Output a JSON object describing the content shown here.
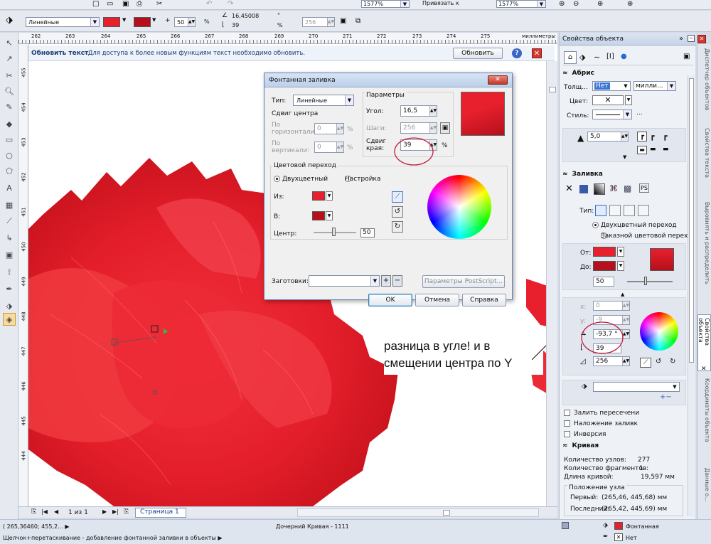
{
  "top_toolbar": {
    "zoom1": "1577%",
    "snap": "Привязать к",
    "zoom2": "1577%"
  },
  "prop_bar": {
    "fill_type": "Линейные",
    "midpoint": "50",
    "midpoint_unit": "%",
    "angle": "16,45008",
    "angle_unit": "°",
    "edge": "39",
    "edge_unit": "%",
    "steps": "256"
  },
  "ruler": {
    "ticks": [
      "262",
      "263",
      "264",
      "265",
      "266",
      "267",
      "268",
      "269",
      "270",
      "271",
      "272",
      "273",
      "274",
      "275"
    ],
    "unit": "миллиметры",
    "vticks": [
      "455",
      "454",
      "453",
      "452",
      "451",
      "450",
      "449",
      "448",
      "447",
      "446",
      "445",
      "444"
    ]
  },
  "update_bar": {
    "title": "Обновить текст",
    "text": " - Для доступа к более новым функциям текст необходимо обновить.",
    "button": "Обновить"
  },
  "dialog": {
    "title": "Фонтанная заливка",
    "type_label": "Тип:",
    "type_value": "Линейные",
    "params_label": "Параметры",
    "center_offset_label": "Сдвиг центра",
    "horiz_label": "По горизонтали:",
    "horiz_value": "0",
    "vert_label": "По вертикали:",
    "vert_value": "0",
    "pct": "%",
    "angle_label": "Угол:",
    "angle_value": "16,5",
    "steps_label": "Шаги:",
    "steps_value": "256",
    "edge_label": "Сдвиг края:",
    "edge_value": "39",
    "color_transition": "Цветовой переход",
    "two_color": "Двухцветный",
    "custom": "Настройка",
    "from": "Из:",
    "to": "В:",
    "center": "Центр:",
    "center_value": "50",
    "presets": "Заготовки:",
    "postscript": "Параметры PostScript...",
    "ok": "OK",
    "cancel": "Отмена",
    "help": "Справка"
  },
  "annotation": {
    "line1": "разница в угле! и в",
    "line2": "смещении центра по Y"
  },
  "panel": {
    "title": "Свойства объекта",
    "outline": {
      "header": "Абрис",
      "width_label": "Толщ...",
      "width_value": "Нет",
      "units": "милли...",
      "color_label": "Цвет:",
      "style_label": "Стиль:",
      "miter": "5,0"
    },
    "fill": {
      "header": "Заливка",
      "type_label": "Тип:",
      "opt_two": "Двухцветный переход",
      "opt_custom": "Заказной цветовой перех",
      "from_label": "От:",
      "to_label": "До:",
      "mid": "50",
      "x": "0",
      "y": "-9",
      "angle": "-93,7 °",
      "edge": "39",
      "steps": "256"
    },
    "checks": [
      "Залить пересечени",
      "Наложение заливк",
      "Инверсия"
    ],
    "curve": {
      "header": "Кривая",
      "nodes_label": "Количество узлов:",
      "nodes_value": "277",
      "frags_label": "Количество фрагментов:",
      "frags_value": "1",
      "len_label": "Длина кривой:",
      "len_value": "19,597 мм",
      "pos_header": "Положение узла",
      "first_label": "Первый:",
      "first_value": "(265,46, 445,68) мм",
      "last_label": "Последний:",
      "last_value": "(265,42, 445,69) мм"
    }
  },
  "side_tabs": [
    "Диспетчер объектов",
    "Свойства текста",
    "Выровнять и распределить",
    "Свойства объекта",
    "Координаты объекта",
    "Данные о..."
  ],
  "page_nav": {
    "count": "1 из 1",
    "page": "Страница 1"
  },
  "status": {
    "coords": "( 265,36460; 455,2... ▶",
    "object": "Дочерний Кривая - 1111",
    "hint": "Щелчок+перетаскивание - добавление фонтанной заливки в объекты ▶",
    "fill_label": "Фонтанная",
    "outline_label": "Нет"
  },
  "colors": {
    "red": "#e8202e",
    "dark_red": "#b5101b",
    "accent": "#d61a24"
  }
}
